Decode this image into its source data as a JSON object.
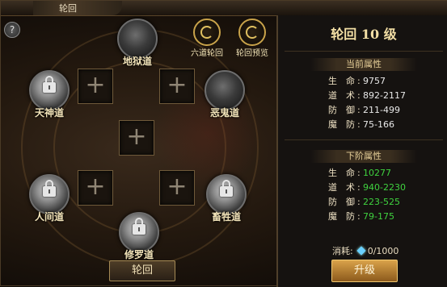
{
  "window": {
    "title": "轮回"
  },
  "help": {
    "label": "?"
  },
  "top_icons": [
    {
      "label": "六道轮回"
    },
    {
      "label": "轮回预览"
    }
  ],
  "realms": {
    "hell": "地狱道",
    "heaven": "天神道",
    "ghost": "恶鬼道",
    "human": "人间道",
    "animal": "畜牲道",
    "asura": "修罗道"
  },
  "slot_symbol": "+",
  "lunhui_button": "轮回",
  "panel": {
    "title": "轮回 10 级",
    "current": {
      "heading": "当前属性",
      "rows": [
        {
          "k1": "生",
          "k2": "命",
          "value": "9757"
        },
        {
          "k1": "道",
          "k2": "术",
          "value": "892-2117"
        },
        {
          "k1": "防",
          "k2": "御",
          "value": "211-499"
        },
        {
          "k1": "魔",
          "k2": "防",
          "value": "75-166"
        }
      ]
    },
    "next": {
      "heading": "下阶属性",
      "rows": [
        {
          "k1": "生",
          "k2": "命",
          "value": "10277"
        },
        {
          "k1": "道",
          "k2": "术",
          "value": "940-2230"
        },
        {
          "k1": "防",
          "k2": "御",
          "value": "223-525"
        },
        {
          "k1": "魔",
          "k2": "防",
          "value": "79-175"
        }
      ]
    },
    "cost_label": "消耗:",
    "cost_value": "0/1000",
    "upgrade_button": "升级"
  },
  "colors": {
    "stat_up": "#3fd23f",
    "gold": "#f3dfa5"
  }
}
